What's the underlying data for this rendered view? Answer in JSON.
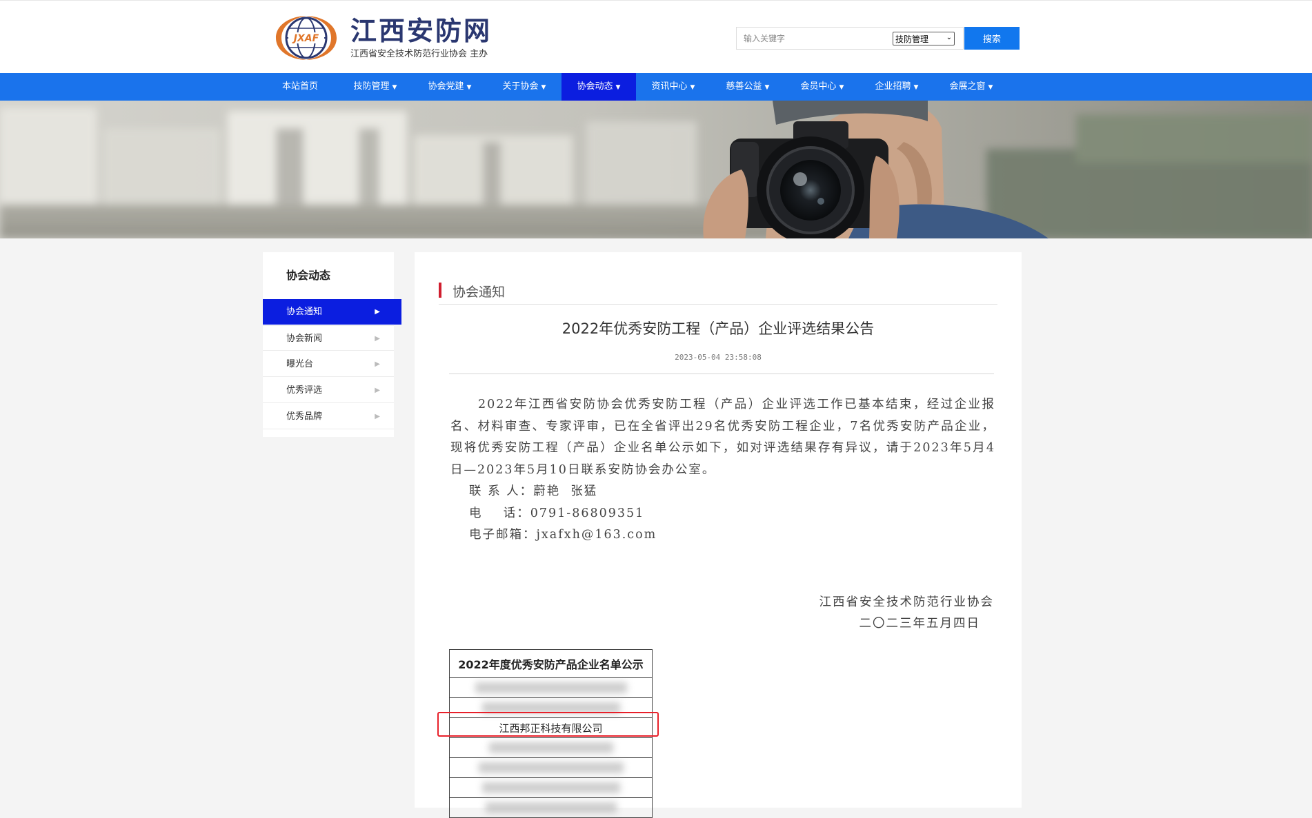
{
  "site": {
    "logo_emblem_text": "JXAF",
    "title": "江西安防网",
    "subtitle": "江西省安全技术防范行业协会 主办"
  },
  "search": {
    "placeholder": "输入关键字",
    "category": "技防管理",
    "button": "搜索"
  },
  "nav": {
    "items": [
      {
        "label": "本站首页",
        "has_caret": false
      },
      {
        "label": "技防管理",
        "has_caret": true
      },
      {
        "label": "协会党建",
        "has_caret": true
      },
      {
        "label": "关于协会",
        "has_caret": true
      },
      {
        "label": "协会动态",
        "has_caret": true,
        "active": true
      },
      {
        "label": "资讯中心",
        "has_caret": true
      },
      {
        "label": "慈善公益",
        "has_caret": true
      },
      {
        "label": "会员中心",
        "has_caret": true
      },
      {
        "label": "企业招聘",
        "has_caret": true
      },
      {
        "label": "会展之窗",
        "has_caret": true
      }
    ]
  },
  "sidebar": {
    "title": "协会动态",
    "items": [
      {
        "label": "协会通知",
        "active": true
      },
      {
        "label": "协会新闻"
      },
      {
        "label": "曝光台"
      },
      {
        "label": "优秀评选"
      },
      {
        "label": "优秀品牌"
      }
    ]
  },
  "section": {
    "title": "协会通知"
  },
  "article": {
    "title": "2022年优秀安防工程（产品）企业评选结果公告",
    "date": "2023-05-04 23:58:08",
    "paragraph": "2022年江西省安防协会优秀安防工程（产品）企业评选工作已基本结束，经过企业报名、材料审查、专家评审，已在全省评出29名优秀安防工程企业，7名优秀安防产品企业，现将优秀安防工程（产品）企业名单公示如下，如对评选结果存有异议，请于2023年5月4日—2023年5月10日联系安防协会办公室。",
    "contact_person": "联 系 人：蔚艳  张猛",
    "contact_phone": "电    话：0791-86809351",
    "contact_email": "电子邮箱：jxafxh@163.com",
    "sign_org": "江西省安全技术防范行业协会",
    "sign_date": "二〇二三年五月四日"
  },
  "product_table": {
    "header": "2022年度优秀安防产品企业名单公示",
    "visible_company": "江西邦正科技有限公司"
  },
  "colors": {
    "nav_bg": "#1a73ec",
    "active": "#0b1ee0",
    "accent_bar": "#d01e2f",
    "highlight": "#e8202a"
  }
}
